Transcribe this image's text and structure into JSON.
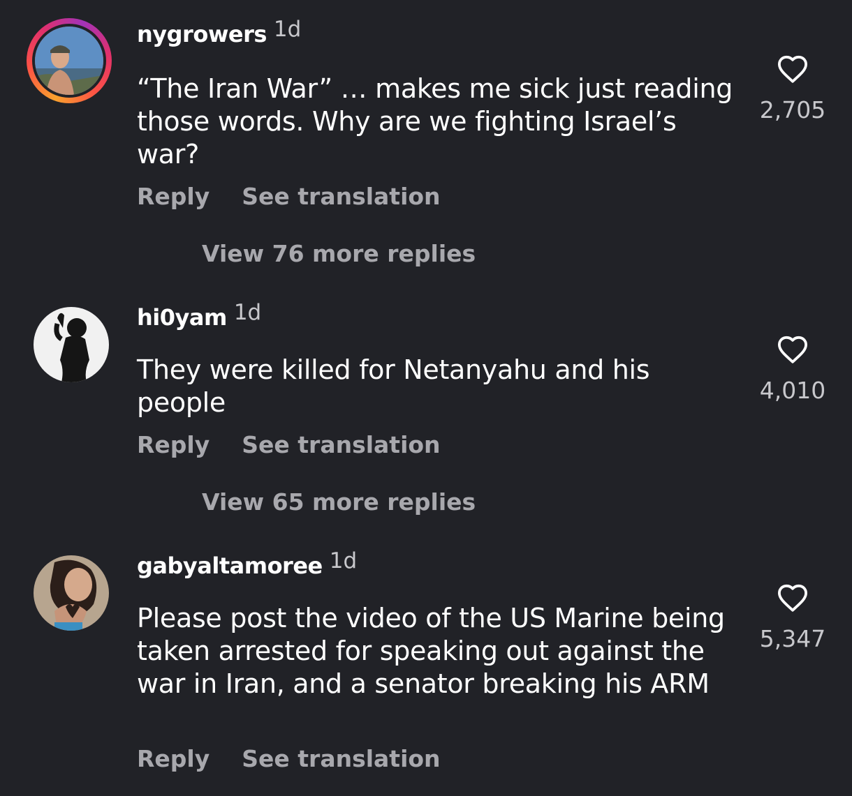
{
  "comments": [
    {
      "username": "nygrowers",
      "time": "1d",
      "text": "“The Iran War” … makes me sick just reading those words. Why are we fighting Israel’s war?",
      "reply": "Reply",
      "translate": "See translation",
      "likes": "2,705",
      "view_replies": "View 76 more replies",
      "avatar_icon": "profile-photo",
      "has_story_ring": true
    },
    {
      "username": "hi0yam",
      "time": "1d",
      "text": "They were killed for Netanyahu and his people",
      "reply": "Reply",
      "translate": "See translation",
      "likes": "4,010",
      "view_replies": "View 65 more replies",
      "avatar_icon": "profile-photo",
      "has_story_ring": false
    },
    {
      "username": "gabyaltamoree",
      "time": "1d",
      "text": "Please post the video of the US Marine being taken arrested for speaking out against the war in Iran, and a senator breaking his ARM",
      "reply": "Reply",
      "translate": "See translation",
      "likes": "5,347",
      "avatar_icon": "profile-photo",
      "has_story_ring": false
    }
  ],
  "like_icon": "heart-outline-icon",
  "colors": {
    "background": "#212227",
    "primary_text": "#ffffff",
    "secondary_text": "#a8a8ad",
    "story_ring": [
      "#f9a12e",
      "#e1306c",
      "#a233b8"
    ]
  }
}
